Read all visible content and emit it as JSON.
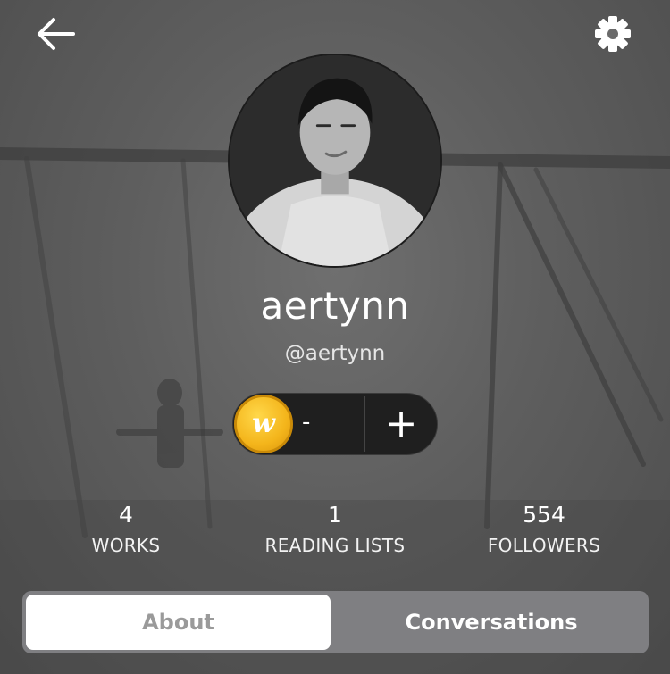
{
  "header": {
    "back_icon": "arrow-left-icon",
    "settings_icon": "gear-icon"
  },
  "profile": {
    "display_name": "aertynn",
    "username": "@aertynn"
  },
  "coins": {
    "icon": "wattpad-coin-icon",
    "coin_letter": "w",
    "value": "-",
    "add_label": "+"
  },
  "stats": [
    {
      "value": "4",
      "label": "WORKS"
    },
    {
      "value": "1",
      "label": "READING LISTS"
    },
    {
      "value": "554",
      "label": "FOLLOWERS"
    }
  ],
  "tabs": [
    {
      "label": "About",
      "active": true
    },
    {
      "label": "Conversations",
      "active": false
    }
  ],
  "colors": {
    "coin": "#f4b51b",
    "tab_bar": "#7f7f82",
    "active_tab_bg": "#ffffff",
    "active_tab_text": "#9a9a9a"
  }
}
